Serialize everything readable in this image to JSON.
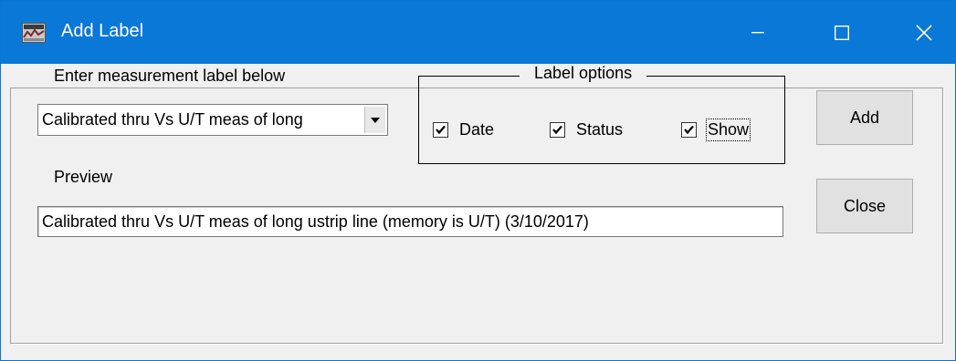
{
  "window": {
    "title": "Add Label",
    "controls": {
      "minimize": "—",
      "maximize": "☐",
      "close": "✕"
    }
  },
  "form": {
    "measurement_label": "Enter measurement label below",
    "combo_value": "Calibrated thru Vs U/T meas of long",
    "preview_label": "Preview",
    "preview_value": "Calibrated thru Vs U/T meas of long ustrip line (memory is U/T)  (3/10/2017)"
  },
  "label_options": {
    "title": "Label options",
    "checkboxes": [
      {
        "label": "Date",
        "checked": true
      },
      {
        "label": "Status",
        "checked": true
      },
      {
        "label": "Show",
        "checked": true
      }
    ]
  },
  "buttons": {
    "add": "Add",
    "close": "Close"
  },
  "colors": {
    "titlebar": "#0a78d7",
    "window_bg": "#f0f0f0",
    "button_bg": "#e1e1e1"
  },
  "icons": {
    "app": "app-icon",
    "dropdown": "chevron-down-icon",
    "check": "checkmark-icon"
  }
}
